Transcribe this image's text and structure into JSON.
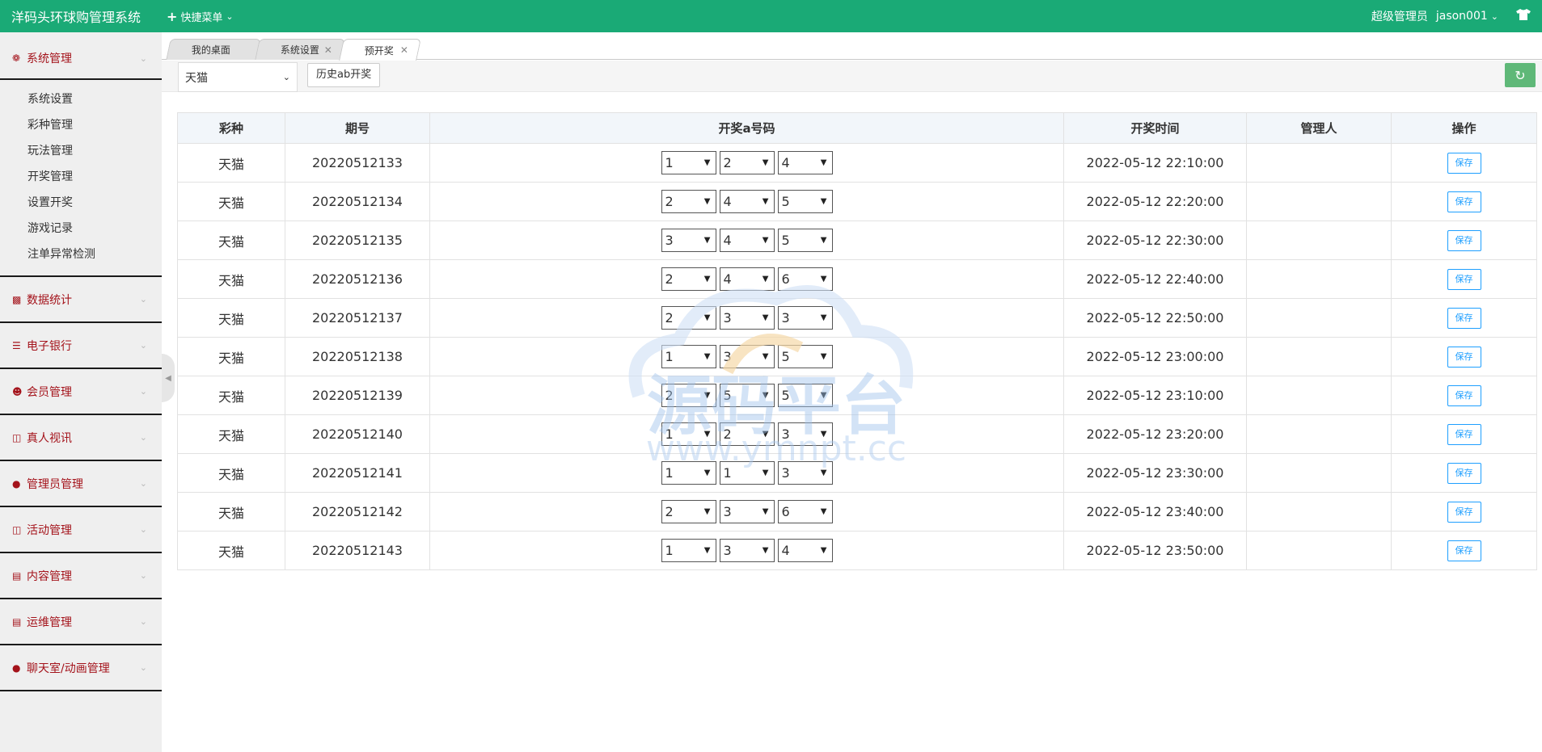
{
  "header": {
    "title": "洋码头环球购管理系统",
    "quick_menu": "快捷菜单",
    "role": "超级管理员",
    "username": "jason001"
  },
  "sidebar": {
    "groups": [
      {
        "label": "系统管理",
        "icon": "gear-icon",
        "items": [
          "系统设置",
          "彩种管理",
          "玩法管理",
          "开奖管理",
          "设置开奖",
          "游戏记录",
          "注单异常检测"
        ]
      },
      {
        "label": "数据统计",
        "icon": "bar-chart-icon"
      },
      {
        "label": "电子银行",
        "icon": "list-icon"
      },
      {
        "label": "会员管理",
        "icon": "user-icon"
      },
      {
        "label": "真人视讯",
        "icon": "gift-icon"
      },
      {
        "label": "管理员管理",
        "icon": "admin-icon"
      },
      {
        "label": "活动管理",
        "icon": "gift-icon"
      },
      {
        "label": "内容管理",
        "icon": "book-icon"
      },
      {
        "label": "运维管理",
        "icon": "book-icon"
      },
      {
        "label": "聊天室/动画管理",
        "icon": "admin-icon"
      }
    ]
  },
  "tabs": [
    {
      "label": "我的桌面",
      "closable": false
    },
    {
      "label": "系统设置",
      "closable": true
    },
    {
      "label": "预开奖",
      "closable": true,
      "active": true
    }
  ],
  "toolbar": {
    "lottery_selected": "天猫",
    "history_button": "历史ab开奖"
  },
  "table": {
    "headers": [
      "彩种",
      "期号",
      "开奖a号码",
      "开奖时间",
      "管理人",
      "操作"
    ],
    "save_label": "保存",
    "rows": [
      {
        "lottery": "天猫",
        "issue": "20220512133",
        "nums": [
          "1",
          "2",
          "4"
        ],
        "time": "2022-05-12 22:10:00",
        "admin": ""
      },
      {
        "lottery": "天猫",
        "issue": "20220512134",
        "nums": [
          "2",
          "4",
          "5"
        ],
        "time": "2022-05-12 22:20:00",
        "admin": ""
      },
      {
        "lottery": "天猫",
        "issue": "20220512135",
        "nums": [
          "3",
          "4",
          "5"
        ],
        "time": "2022-05-12 22:30:00",
        "admin": ""
      },
      {
        "lottery": "天猫",
        "issue": "20220512136",
        "nums": [
          "2",
          "4",
          "6"
        ],
        "time": "2022-05-12 22:40:00",
        "admin": ""
      },
      {
        "lottery": "天猫",
        "issue": "20220512137",
        "nums": [
          "2",
          "3",
          "3"
        ],
        "time": "2022-05-12 22:50:00",
        "admin": ""
      },
      {
        "lottery": "天猫",
        "issue": "20220512138",
        "nums": [
          "1",
          "3",
          "5"
        ],
        "time": "2022-05-12 23:00:00",
        "admin": ""
      },
      {
        "lottery": "天猫",
        "issue": "20220512139",
        "nums": [
          "2",
          "5",
          "5"
        ],
        "time": "2022-05-12 23:10:00",
        "admin": ""
      },
      {
        "lottery": "天猫",
        "issue": "20220512140",
        "nums": [
          "1",
          "2",
          "3"
        ],
        "time": "2022-05-12 23:20:00",
        "admin": ""
      },
      {
        "lottery": "天猫",
        "issue": "20220512141",
        "nums": [
          "1",
          "1",
          "3"
        ],
        "time": "2022-05-12 23:30:00",
        "admin": ""
      },
      {
        "lottery": "天猫",
        "issue": "20220512142",
        "nums": [
          "2",
          "3",
          "6"
        ],
        "time": "2022-05-12 23:40:00",
        "admin": ""
      },
      {
        "lottery": "天猫",
        "issue": "20220512143",
        "nums": [
          "1",
          "3",
          "4"
        ],
        "time": "2022-05-12 23:50:00",
        "admin": ""
      }
    ]
  },
  "watermark": {
    "text": "源码平台",
    "url": "www.ymnpt.cc"
  },
  "colors": {
    "header_bg": "#1aaa76",
    "menu_text": "#a4131b",
    "save_button": "#1e9fff",
    "refresh_button": "#5fb878"
  }
}
